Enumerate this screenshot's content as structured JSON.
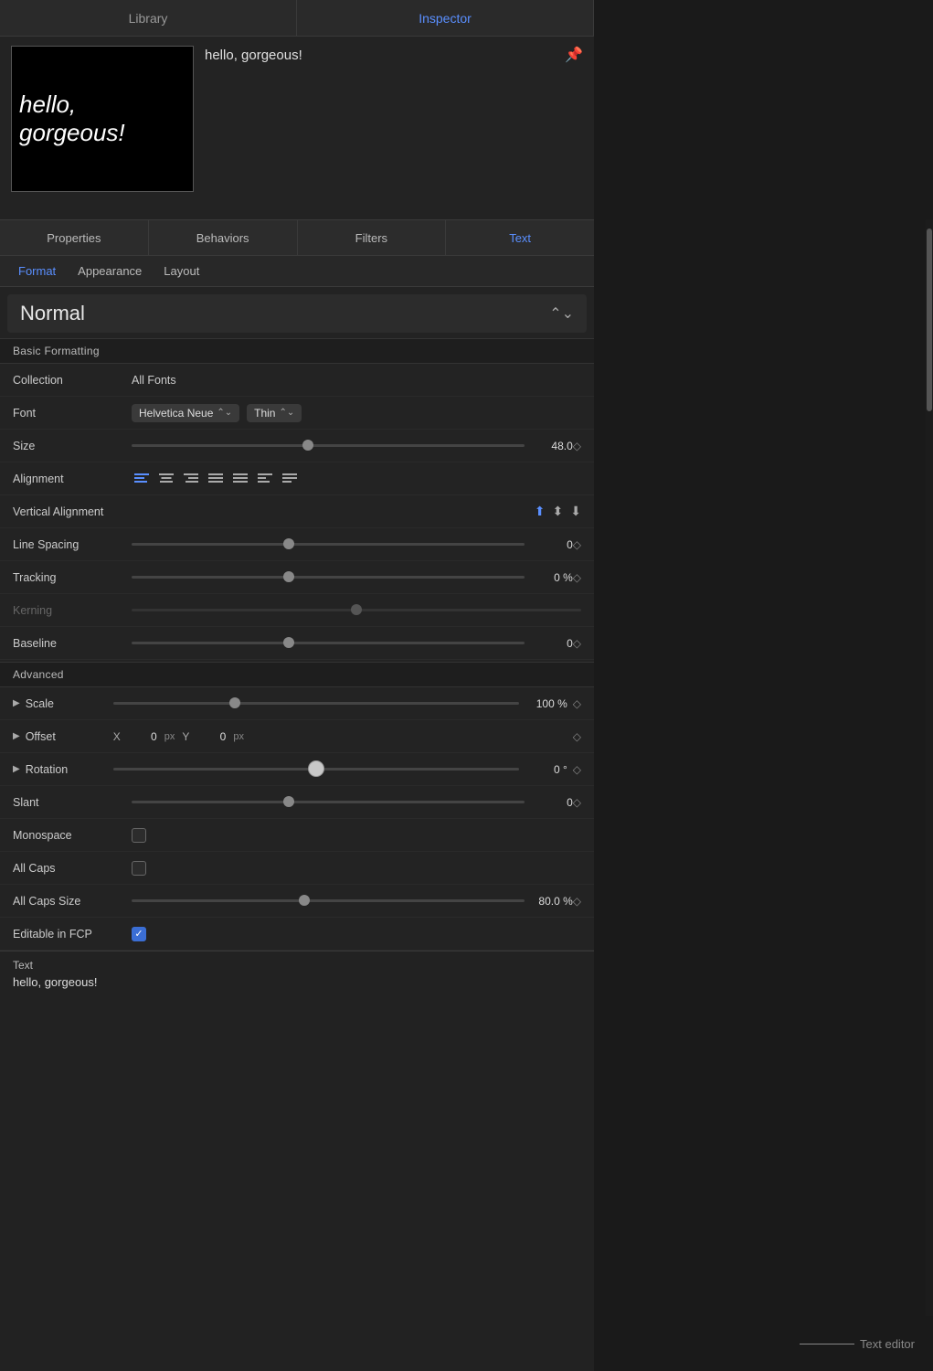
{
  "topTabs": [
    {
      "label": "Library",
      "active": false
    },
    {
      "label": "Inspector",
      "active": true
    }
  ],
  "preview": {
    "thumbnailText": "hello, gorgeous!",
    "title": "hello, gorgeous!",
    "pinIcon": "📌"
  },
  "sectionTabs": [
    {
      "label": "Properties",
      "active": false
    },
    {
      "label": "Behaviors",
      "active": false
    },
    {
      "label": "Filters",
      "active": false
    },
    {
      "label": "Text",
      "active": true
    }
  ],
  "subTabs": [
    {
      "label": "Format",
      "active": true
    },
    {
      "label": "Appearance",
      "active": false
    },
    {
      "label": "Layout",
      "active": false
    }
  ],
  "styleDropdown": {
    "value": "Normal"
  },
  "basicFormatting": {
    "header": "Basic Formatting",
    "fields": [
      {
        "label": "Collection",
        "value": "All Fonts",
        "type": "text"
      },
      {
        "label": "Font",
        "value": "Helvetica Neue",
        "weight": "Thin",
        "type": "font"
      },
      {
        "label": "Size",
        "value": "48.0",
        "sliderPos": 45,
        "type": "slider"
      },
      {
        "label": "Alignment",
        "type": "alignment"
      },
      {
        "label": "Vertical Alignment",
        "type": "vert-alignment"
      },
      {
        "label": "Line Spacing",
        "value": "0",
        "sliderPos": 40,
        "type": "slider"
      },
      {
        "label": "Tracking",
        "value": "0 %",
        "sliderPos": 40,
        "type": "slider"
      },
      {
        "label": "Kerning",
        "type": "slider-disabled",
        "sliderPos": 50
      },
      {
        "label": "Baseline",
        "value": "0",
        "sliderPos": 40,
        "type": "slider"
      }
    ]
  },
  "advanced": {
    "header": "Advanced",
    "fields": [
      {
        "label": "Scale",
        "value": "100 %",
        "sliderPos": 30,
        "type": "expander-slider"
      },
      {
        "label": "Offset",
        "xValue": "0",
        "yValue": "0",
        "type": "expander-offset"
      },
      {
        "label": "Rotation",
        "value": "0 °",
        "sliderPos": 50,
        "type": "expander-rotation"
      },
      {
        "label": "Slant",
        "value": "0",
        "sliderPos": 40,
        "type": "slider"
      },
      {
        "label": "Monospace",
        "checked": false,
        "type": "checkbox"
      },
      {
        "label": "All Caps",
        "checked": false,
        "type": "checkbox"
      },
      {
        "label": "All Caps Size",
        "value": "80.0 %",
        "sliderPos": 44,
        "type": "slider"
      },
      {
        "label": "Editable in FCP",
        "checked": true,
        "type": "checkbox"
      }
    ]
  },
  "textEditor": {
    "label": "Text",
    "content": "hello, gorgeous!",
    "annotation": "Text editor"
  },
  "alignmentButtons": [
    {
      "icon": "≡",
      "active": true,
      "title": "align-left"
    },
    {
      "icon": "≡",
      "active": false,
      "title": "align-center"
    },
    {
      "icon": "≡",
      "active": false,
      "title": "align-right"
    },
    {
      "icon": "≡",
      "active": false,
      "title": "align-justify"
    },
    {
      "icon": "≡",
      "active": false,
      "title": "align-force"
    },
    {
      "icon": "≡",
      "active": false,
      "title": "align-natural"
    },
    {
      "icon": "≡",
      "active": false,
      "title": "align-wrap"
    }
  ]
}
